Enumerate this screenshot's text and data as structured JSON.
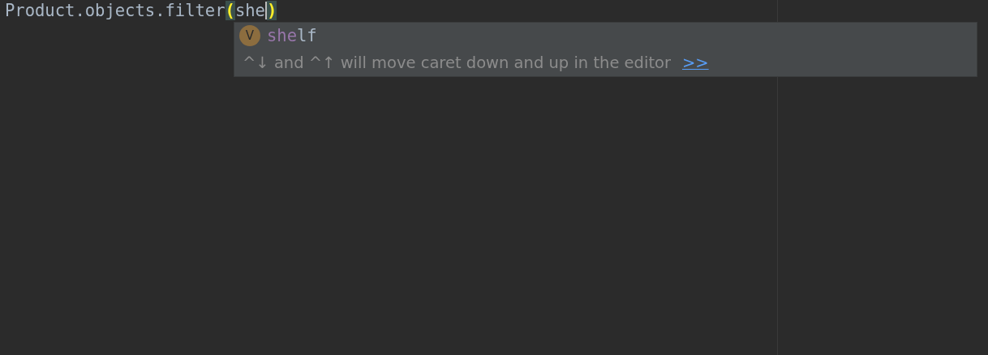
{
  "editor": {
    "code_line": {
      "before": "Product.objects.filter",
      "open_paren": "(",
      "typed": "she",
      "close_paren": ")"
    }
  },
  "completion_popup": {
    "items": [
      {
        "badge": "V",
        "match": "she",
        "rest": "lf"
      }
    ],
    "hint": {
      "text": "^↓ and ^↑ will move caret down and up in the editor",
      "link": ">>"
    }
  }
}
